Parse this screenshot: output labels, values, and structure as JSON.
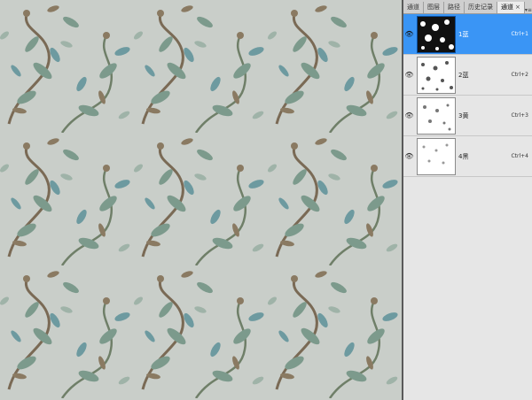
{
  "tabs": [
    {
      "label": "通道"
    },
    {
      "label": "图层"
    },
    {
      "label": "路径"
    },
    {
      "label": "历史记录"
    },
    {
      "label": "通道",
      "active": true,
      "close": "×"
    }
  ],
  "panel_menu_icon": "menu-icon",
  "channels": [
    {
      "name": "1蓝",
      "shortcut": "Ctrl+1",
      "selected": true
    },
    {
      "name": "2蓝",
      "shortcut": "Ctrl+2",
      "selected": false
    },
    {
      "name": "3黄",
      "shortcut": "Ctrl+3",
      "selected": false
    },
    {
      "name": "4黑",
      "shortcut": "Ctrl+4",
      "selected": false
    }
  ],
  "colors": {
    "canvas_bg": "#c9cec9",
    "leaf_green": "#7c9a8c",
    "leaf_teal": "#6d9aa0",
    "leaf_brown": "#7a6a55",
    "selection_blue": "#3a95f5"
  }
}
